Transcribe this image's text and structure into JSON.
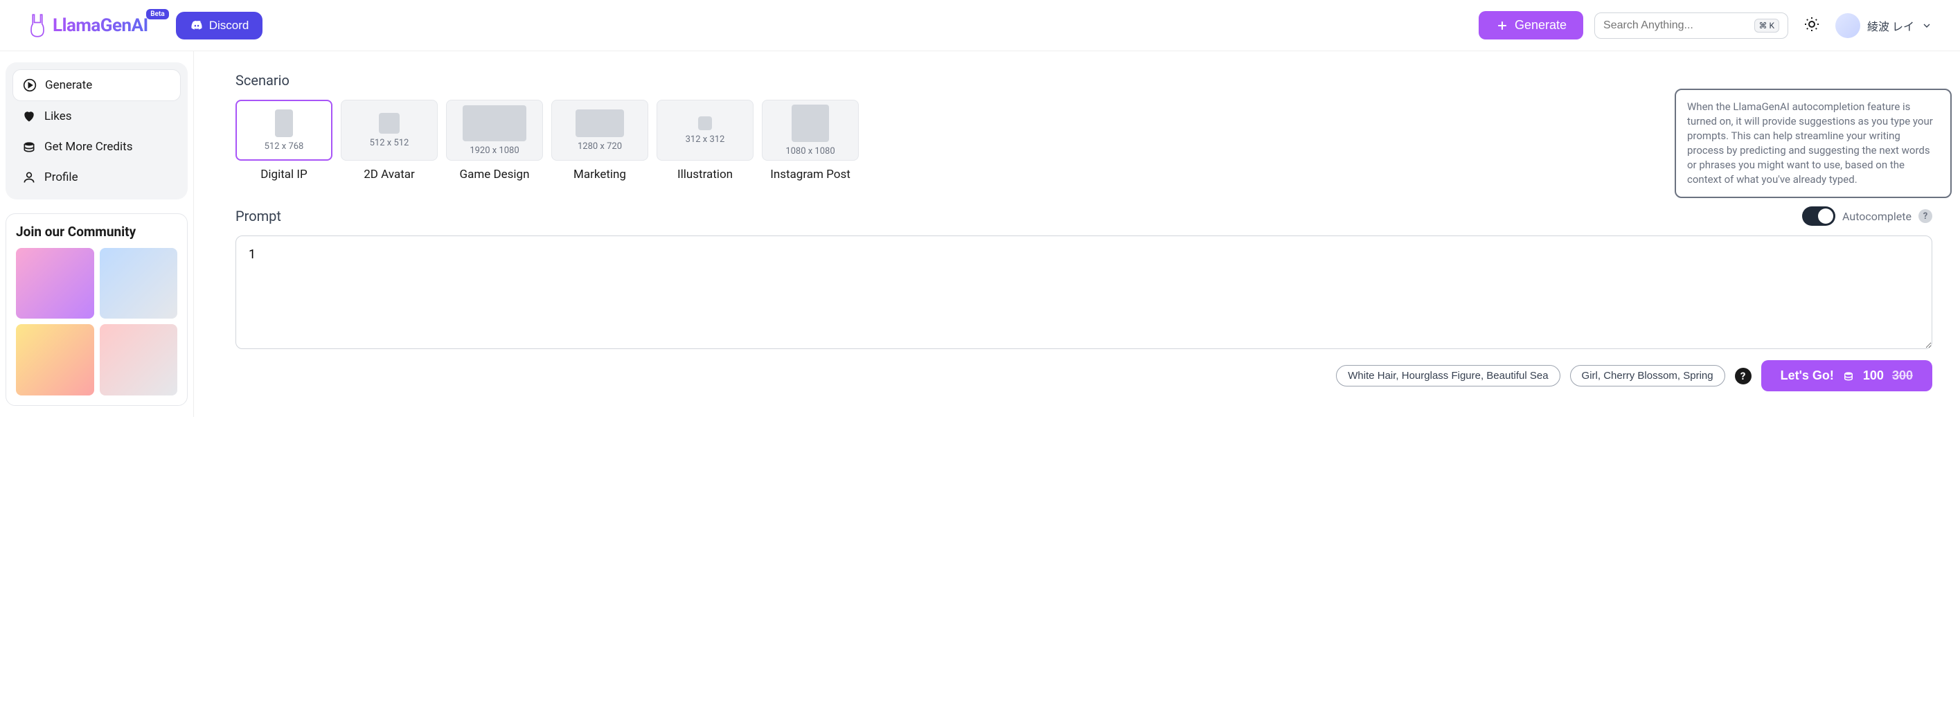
{
  "header": {
    "logo_text": "LlamaGenAI",
    "beta": "Beta",
    "discord": "Discord",
    "generate": "Generate",
    "search_placeholder": "Search Anything...",
    "kbd": "⌘ K",
    "user_name": "綾波 レイ"
  },
  "sidebar": {
    "items": [
      {
        "label": "Generate",
        "active": true
      },
      {
        "label": "Likes"
      },
      {
        "label": "Get More Credits"
      },
      {
        "label": "Profile"
      }
    ],
    "community_title": "Join our Community"
  },
  "scenario": {
    "title": "Scenario",
    "items": [
      {
        "label": "Digital IP",
        "dims": "512 x 768",
        "w": 26,
        "h": 40,
        "selected": true
      },
      {
        "label": "2D Avatar",
        "dims": "512 x 512",
        "w": 30,
        "h": 30
      },
      {
        "label": "Game Design",
        "dims": "1920 x 1080",
        "w": 92,
        "h": 52
      },
      {
        "label": "Marketing",
        "dims": "1280 x 720",
        "w": 70,
        "h": 40
      },
      {
        "label": "Illustration",
        "dims": "312 x 312",
        "w": 20,
        "h": 20
      },
      {
        "label": "Instagram Post",
        "dims": "1080 x 1080",
        "w": 54,
        "h": 54
      }
    ]
  },
  "prompt": {
    "title": "Prompt",
    "value": "1",
    "autocomplete_label": "Autocomplete",
    "tooltip": "When the LlamaGenAI autocompletion feature is turned on, it will provide suggestions as you type your prompts. This can help streamline your writing process by predicting and suggesting the next words or phrases you might want to use, based on the context of what you've already typed."
  },
  "actions": {
    "tags": [
      "White Hair, Hourglass Figure, Beautiful Sea",
      "Girl, Cherry Blossom, Spring"
    ],
    "go_label": "Let's Go!",
    "credit_new": "100",
    "credit_old": "300"
  }
}
